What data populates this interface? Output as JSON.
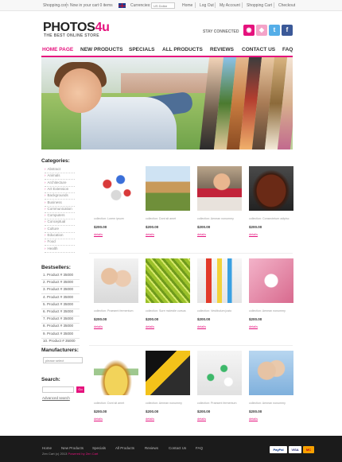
{
  "topbar": {
    "site": "Shopping.com",
    "cart": "Now in your cart 0 items",
    "currencies_label": "Currencies:",
    "currency_value": "US Dollar",
    "links": [
      "Home",
      "Log Out",
      "My Account",
      "Shopping Cart",
      "Checkout"
    ]
  },
  "header": {
    "logo_main": "PHOTOS",
    "logo_accent": "4u",
    "tagline": "THE BEST ONLINE STORE",
    "stay_connected": "STAY CONNECTED",
    "social": [
      {
        "icon": "rss-icon",
        "color": "#e5127d",
        "glyph": "◉"
      },
      {
        "icon": "tag-icon",
        "color": "#f4a3c8",
        "glyph": "◆"
      },
      {
        "icon": "twitter-icon",
        "color": "#55aee8",
        "glyph": "t"
      },
      {
        "icon": "facebook-icon",
        "color": "#3b5998",
        "glyph": "f"
      }
    ]
  },
  "nav": [
    "HOME PAGE",
    "NEW PRODUCTS",
    "SPECIALS",
    "ALL PRODUCTS",
    "REVIEWS",
    "CONTACT US",
    "FAQ"
  ],
  "sidebar": {
    "categories_title": "Categories:",
    "categories": [
      "Abstract",
      "Animals",
      "Architecture",
      "Art Extension",
      "Backgrounds",
      "Business",
      "Communication",
      "Computers",
      "Conceptual",
      "Culture",
      "Education",
      "Food",
      "Health"
    ],
    "bestsellers_title": "Bestsellers:",
    "bestsellers": [
      "1. Product # 35000",
      "2. Product # 35000",
      "3. Product # 35000",
      "4. Product # 35000",
      "5. Product # 35000",
      "6. Product # 35000",
      "7. Product # 35000",
      "8. Product # 35000",
      "9. Product # 35000",
      "10. Product # 35000"
    ],
    "manufacturers_title": "Manufacturers:",
    "manufacturers_select": "please select",
    "search_title": "Search:",
    "search_button": "Go",
    "advanced_search": "Advanced search"
  },
  "products": [
    {
      "thumb": "molecule",
      "desc": "collection: Lorem ipsum",
      "price": "$200.00",
      "details": "details"
    },
    {
      "thumb": "farmer",
      "desc": "collection: Dont sit amet",
      "price": "$200.00",
      "details": "details"
    },
    {
      "thumb": "woman-book",
      "desc": "collection: Aenean nonummy",
      "price": "$200.00",
      "details": "details"
    },
    {
      "thumb": "steak",
      "desc": "collection: Consectetuer adipisc",
      "price": "$200.00",
      "details": "details"
    },
    {
      "thumb": "mother-daughter",
      "desc": "collection: Praesent fermentum",
      "price": "$200.00",
      "details": "details"
    },
    {
      "thumb": "palm-leaf",
      "desc": "collection: Sure molestie cursus",
      "price": "$200.00",
      "details": "details"
    },
    {
      "thumb": "chemistry",
      "desc": "collection: Vestibulum justo",
      "price": "$200.00",
      "details": "details"
    },
    {
      "thumb": "teeth",
      "desc": "collection: Aenean nonummy",
      "price": "$200.00",
      "details": "details"
    },
    {
      "thumb": "breakfast",
      "desc": "collection: Dont sit amet",
      "price": "$200.00",
      "details": "details"
    },
    {
      "thumb": "fuel-nozzle",
      "desc": "collection: Aenean nonummy",
      "price": "$200.00",
      "details": "details"
    },
    {
      "thumb": "pills",
      "desc": "collection: Praesent fermentum",
      "price": "$200.00",
      "details": "details"
    },
    {
      "thumb": "elderly-couple",
      "desc": "collection: Aenean nonummy",
      "price": "$200.00",
      "details": "details"
    }
  ],
  "footer": {
    "links": [
      "Home",
      "New Products",
      "Specials",
      "All Products",
      "Reviews",
      "Contact Us",
      "FAQ"
    ],
    "copyright": "Zen Cart (c) 2013",
    "powered": "Powered by Zen Cart",
    "payments": [
      "PayPal",
      "VISA",
      "MC"
    ]
  },
  "colors": {
    "accent": "#e5127d",
    "footer_bg": "#1b1b1b"
  }
}
